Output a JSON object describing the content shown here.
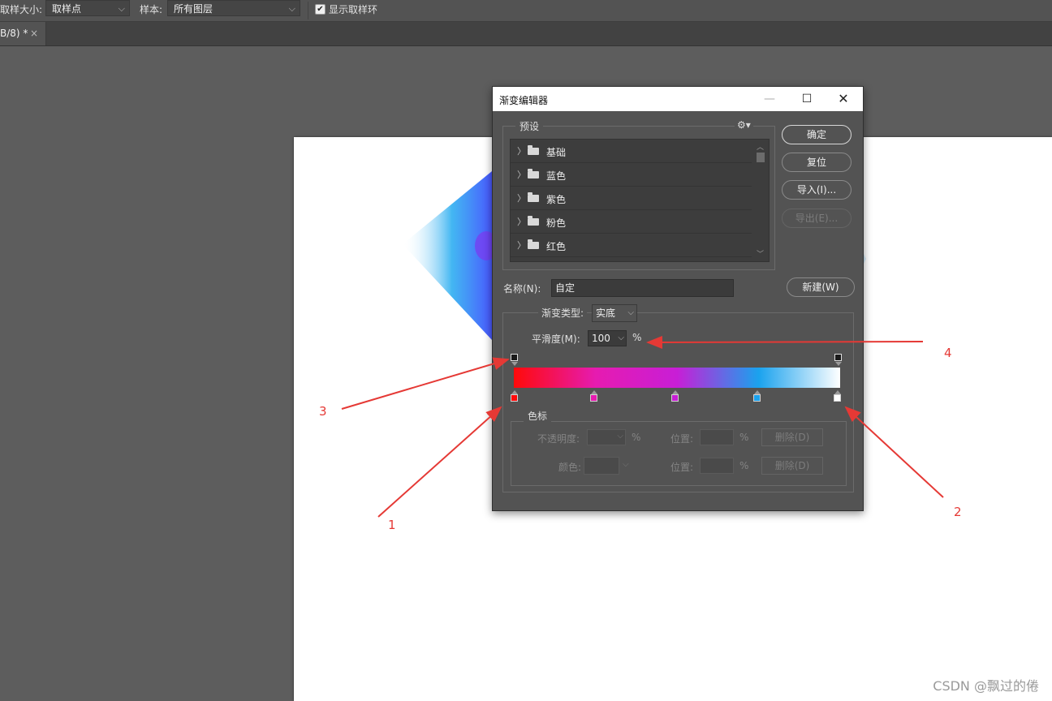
{
  "options_bar": {
    "sample_size_label": "取样大小:",
    "sample_size_value": "取样点",
    "sample_label": "样本:",
    "sample_value": "所有图层",
    "show_ring_label": "显示取样环",
    "show_ring_checked": true
  },
  "tab": {
    "title": "B/8) *",
    "close": "×"
  },
  "dialog": {
    "title": "渐变编辑器",
    "presets_label": "预设",
    "presets": [
      {
        "label": "基础"
      },
      {
        "label": "蓝色"
      },
      {
        "label": "紫色"
      },
      {
        "label": "粉色"
      },
      {
        "label": "红色"
      }
    ],
    "buttons": {
      "ok": "确定",
      "reset": "复位",
      "import": "导入(I)...",
      "export": "导出(E)...",
      "new": "新建(W)"
    },
    "name_label": "名称(N):",
    "name_value": "自定",
    "gradient_type_label": "渐变类型:",
    "gradient_type_value": "实底",
    "smoothness_label": "平滑度(M):",
    "smoothness_value": "100",
    "smoothness_unit": "%",
    "gradient_colors": [
      "#ff0a0a",
      "#e61bb0",
      "#c81ed6",
      "#1aa2ee",
      "#ffffff"
    ],
    "stops_group_label": "色标",
    "opacity_label": "不透明度:",
    "percent": "%",
    "position_label": "位置:",
    "delete_label": "删除(D)",
    "color_label": "颜色:"
  },
  "annotations": {
    "n1": "1",
    "n2": "2",
    "n3": "3",
    "n4": "4",
    "color": "#e53935"
  },
  "watermark": "CSDN @飘过的倦"
}
